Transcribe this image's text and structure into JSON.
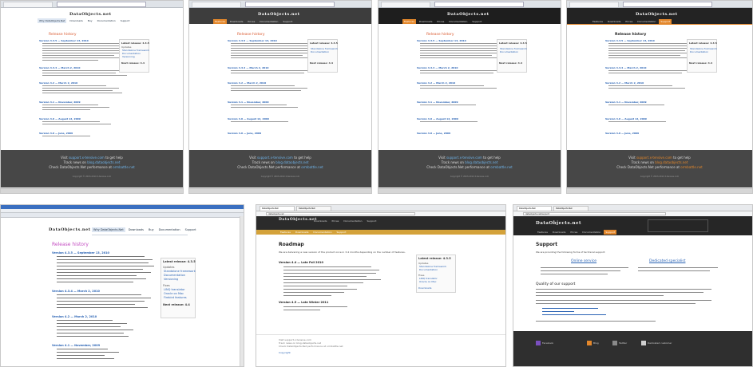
{
  "site": {
    "logo": "DataObjects.net",
    "logo_alt": "DataObjects.net",
    "nav": [
      "Why DataObjects.Net",
      "Downloads",
      "Buy",
      "Documentation",
      "Support"
    ],
    "nav_big": [
      "Features",
      "Downloads",
      "Prices",
      "Documentation",
      "Support"
    ]
  },
  "release_history": {
    "title": "Release history",
    "versions": [
      {
        "heading": "Version 4.3.5 — September 13, 2010"
      },
      {
        "heading": "Version 4.3.4 — March 2, 2010"
      },
      {
        "heading": "Version 4.2 — March 2, 2010"
      },
      {
        "heading": "Version 4.1 — November, 2009"
      },
      {
        "heading": "Version 4.0 — August 12, 2009"
      },
      {
        "heading": "Version 4.0 — June, 2009"
      }
    ],
    "sidebar": {
      "latest_label": "Latest release: 4.3.5",
      "next_label": "Next release: 4.4",
      "items": [
        "Updates",
        "Standalone framework",
        "Documentation",
        "Versioning",
        "Fixes",
        "LINQ translator",
        "Oracle on Mac",
        "Firebird features"
      ]
    },
    "footer": {
      "line1_pre": "Visit ",
      "line1_link": "support.x-tensive.com",
      "line1_post": " to get help",
      "line2_pre": "Track news on ",
      "line2_link": "blog.dataobjects.net",
      "line3_pre": "Check DataObjects.Net performance at ",
      "line3_link": "ormbattle.net",
      "copyright": "Copyright © 2003-2010 X-tensive.com"
    }
  },
  "roadmap": {
    "title": "Roadmap",
    "intro": "We are delivering a new version of the product once in 3-4 months depending on the number of features.",
    "v1_heading": "Version 4.4 — Late Fall 2010",
    "v2_heading": "Version 4.5 — Late Winter 2011",
    "sidebar_title": "Latest release: 4.3.5",
    "sidebar_link": "Downloads",
    "footer_line1": "Visit support.x-tensive.com",
    "footer_line2": "Track news on blog.dataobjects.net",
    "footer_line3": "Check DataObjects.Net performance at ormbattle.net",
    "copyright": "Copyright"
  },
  "support": {
    "title": "Support",
    "intro": "We are providing the following forms of technical support:",
    "col1_link": "Online service",
    "col2_link": "Dedicated specialist",
    "quality_title": "Quality of our support",
    "footer_items": [
      "Facebook",
      "Blog",
      "Twitter",
      "Dedicated customer"
    ]
  }
}
